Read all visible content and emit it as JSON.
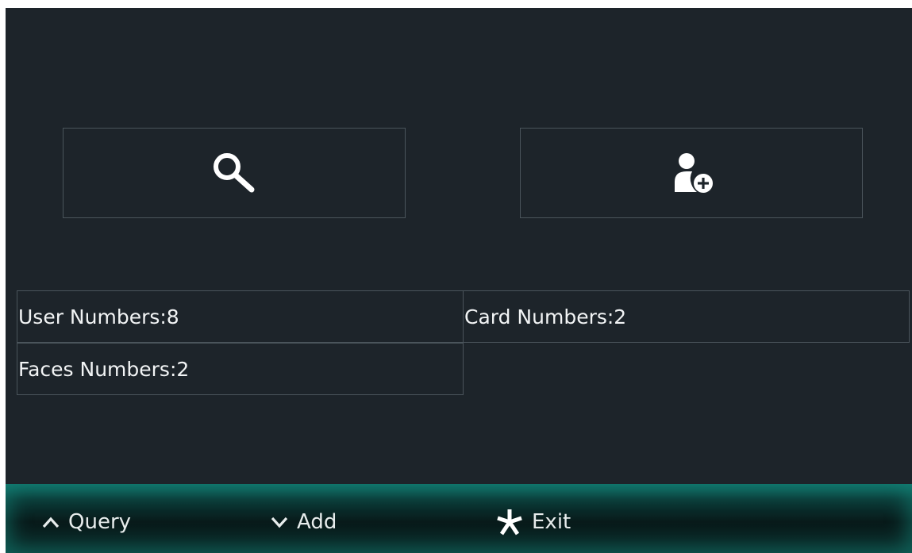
{
  "actions": {
    "query_icon": "search-icon",
    "add_icon": "add-user-icon"
  },
  "stats": {
    "user_numbers": "User Numbers:8",
    "card_numbers": "Card Numbers:2",
    "faces_numbers": "Faces Numbers:2"
  },
  "footer": {
    "query_label": "Query",
    "add_label": "Add",
    "exit_label": "Exit"
  },
  "colors": {
    "background": "#1d242a",
    "border": "#4a545b",
    "footer_teal": "#0f6860",
    "text": "#f2f4f5"
  }
}
